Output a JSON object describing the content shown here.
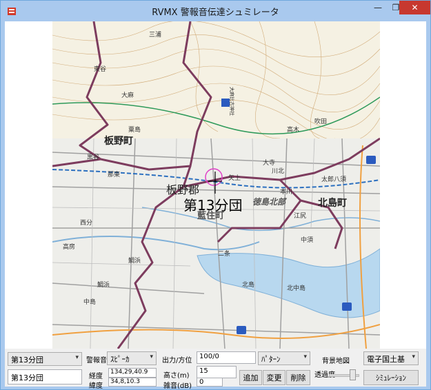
{
  "window": {
    "title": "RVMX 警報音伝達シュミレータ",
    "minimize_glyph": "—",
    "maximize_glyph": "❐",
    "close_glyph": "✕"
  },
  "map": {
    "town_labels": [
      "板野町",
      "北島町",
      "板野郡",
      "藍住町",
      "徳島北部"
    ],
    "selected_label": "第13分団",
    "place_labels": [
      "三浦",
      "大麻比古神社",
      "東谷",
      "大麻",
      "粟島",
      "黒谷",
      "那東",
      "大寺",
      "矢上",
      "二条",
      "吹田",
      "川北",
      "中島",
      "高房",
      "鯛浜",
      "北中島",
      "高木",
      "本川",
      "太郎八須",
      "江尻",
      "鯛浜",
      "西分",
      "北島",
      "中須"
    ],
    "colors": {
      "road": "#8a8a8a",
      "boundary": "#7d3c5e",
      "river": "#7fb0d8",
      "water": "#b8d8ef",
      "rail": "#2b6fbf",
      "marker": "#e040c8"
    }
  },
  "controls": {
    "unit_select": "第13分団",
    "unit_name_input": "第13分団",
    "alarm_label": "警報音",
    "alarm_select": "ｽﾋﾟｰｶ",
    "longitude_label": "経度",
    "longitude_value": "134,29,40.9",
    "latitude_label": "緯度",
    "latitude_value": "34,8,10.3",
    "output_label": "出力/方位",
    "output_value": "100/0",
    "height_label": "高さ(m)",
    "height_value": "15",
    "noise_label": "雑音(dB)",
    "noise_value": "0",
    "pattern_select": "ﾊﾟﾀｰﾝ",
    "add_button": "追加",
    "change_button": "変更",
    "delete_button": "削除",
    "background_map_label": "背景地図",
    "transparency_label": "透過度",
    "transparency_level": 0.85,
    "basemap_select": "電子国土基",
    "simulate_button": "ｼﾐｭﾚｰｼｮﾝ"
  }
}
